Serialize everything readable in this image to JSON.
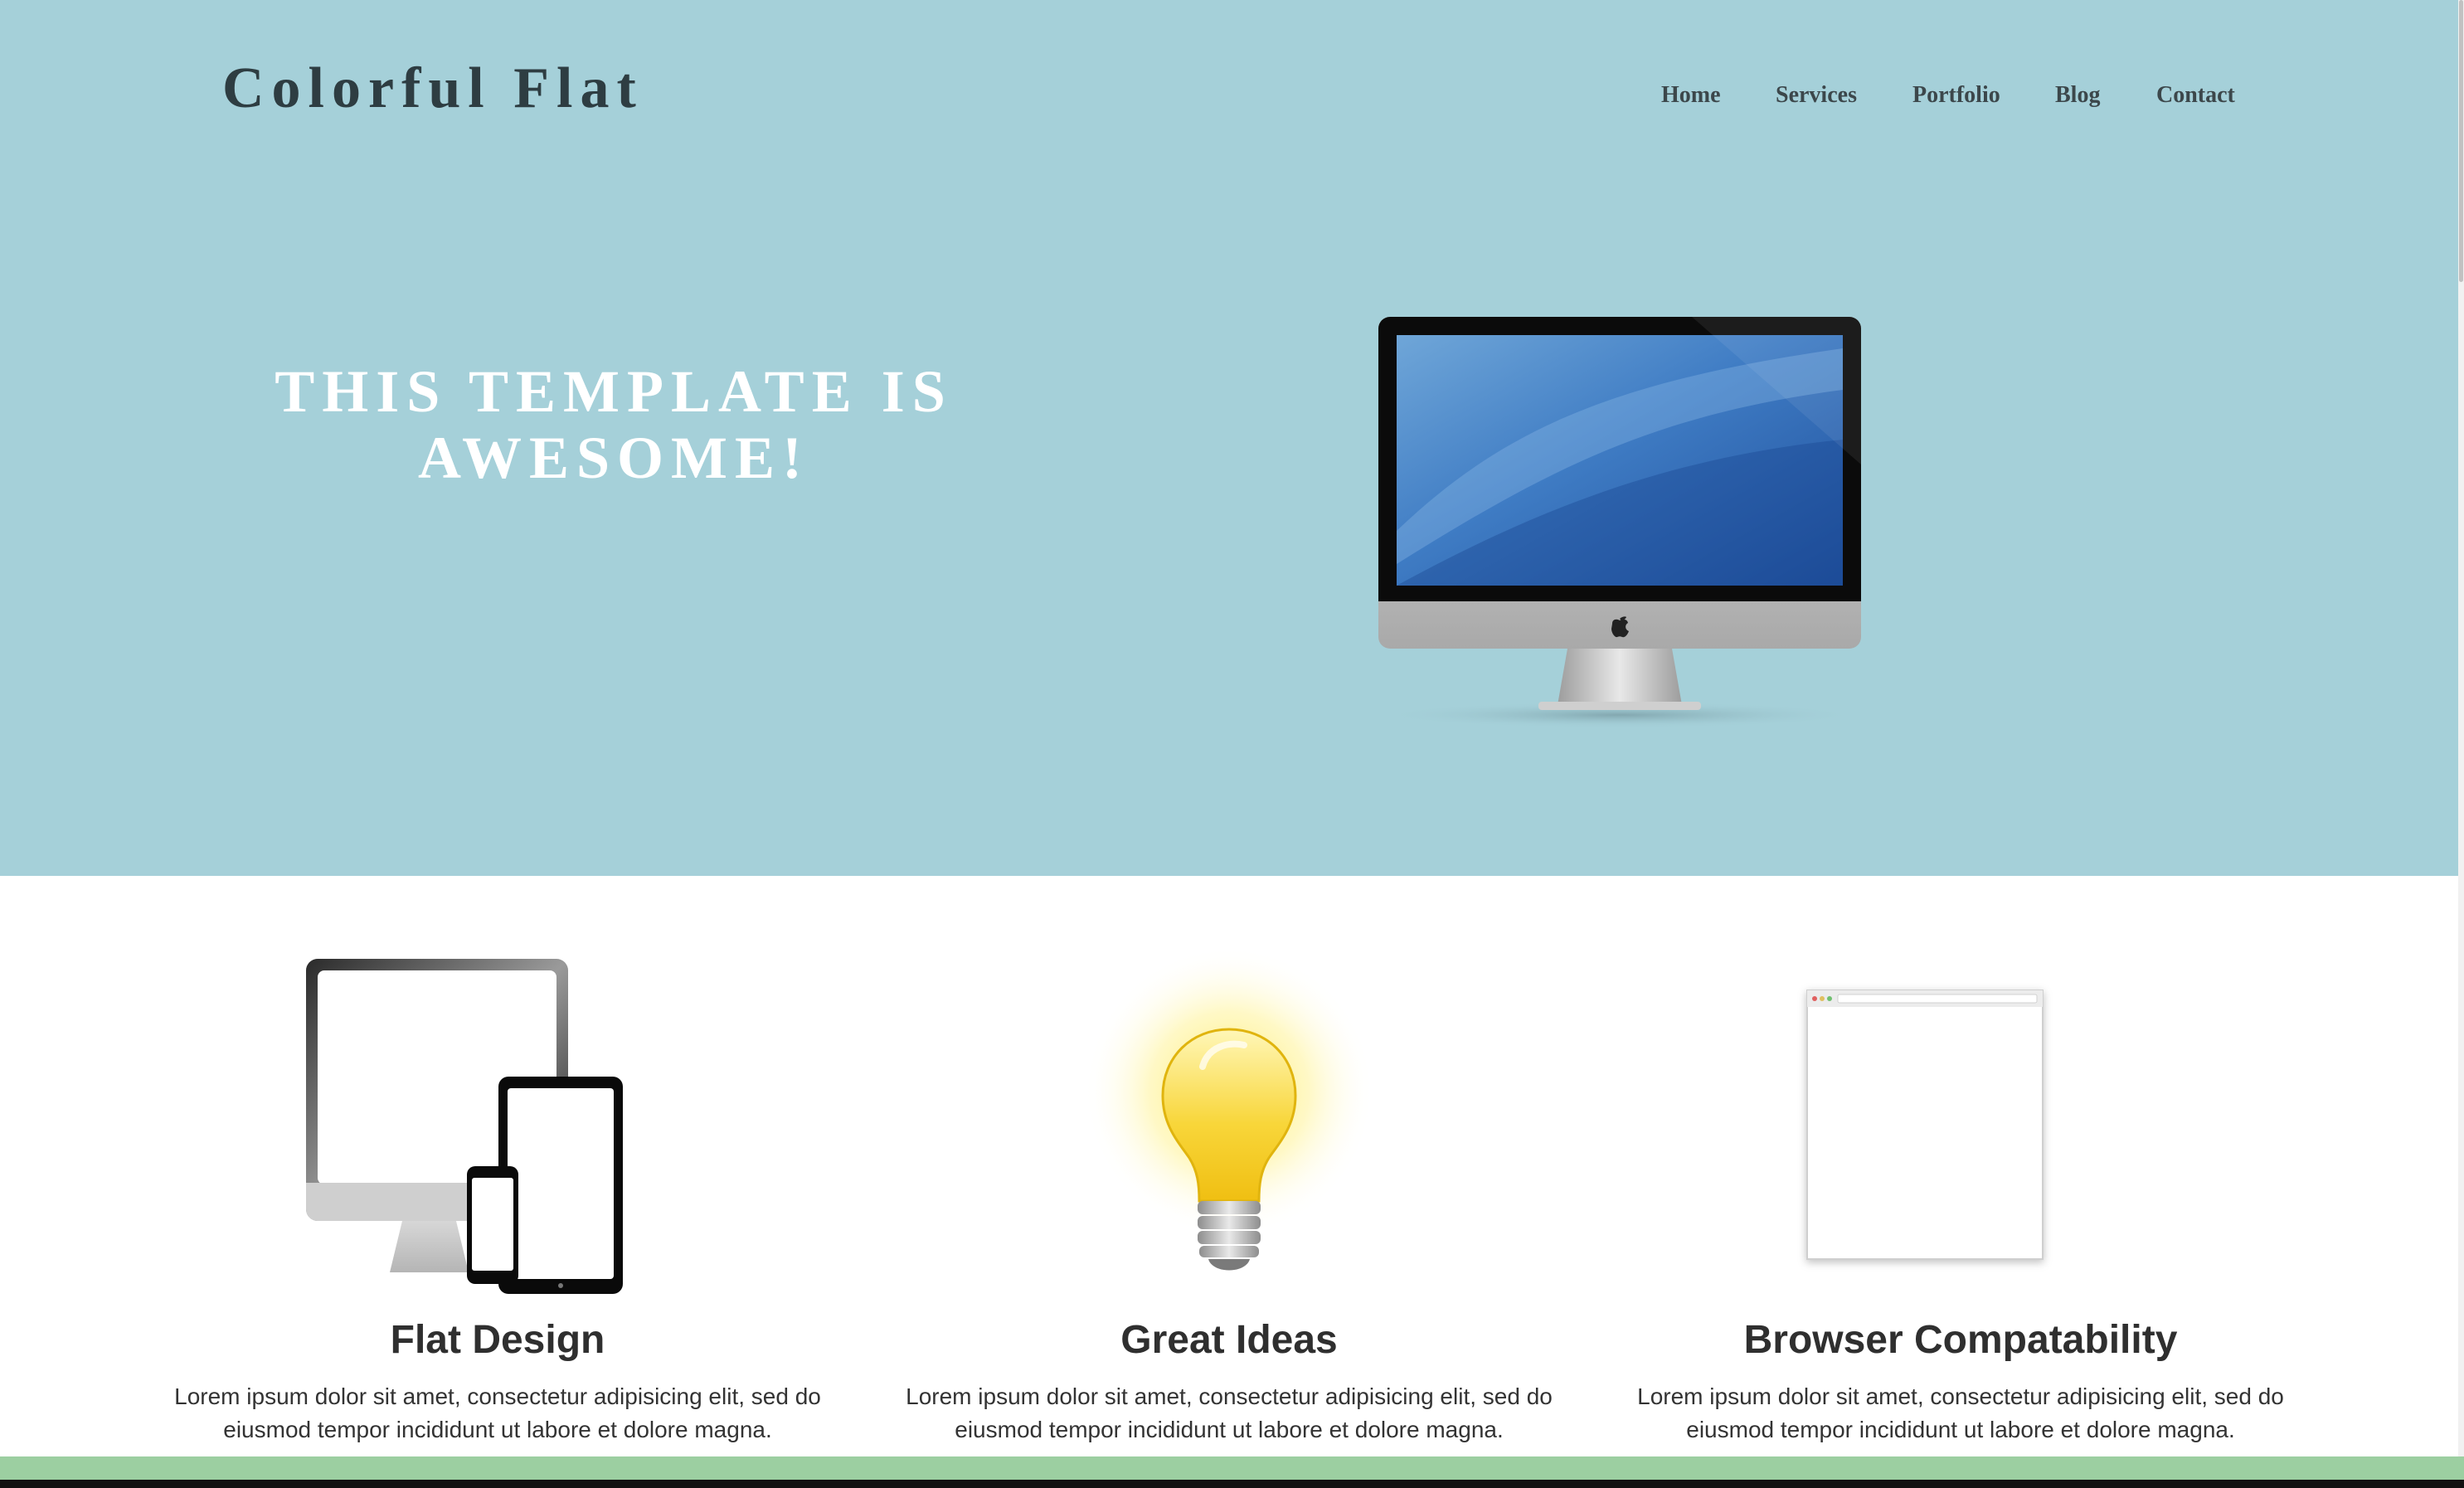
{
  "site": {
    "title": "Colorful Flat"
  },
  "nav": {
    "items": [
      "Home",
      "Services",
      "Portfolio",
      "Blog",
      "Contact"
    ]
  },
  "hero": {
    "line1": "THIS TEMPLATE IS",
    "line2": "AWESOME!"
  },
  "features": [
    {
      "title": "Flat Design",
      "text_line1": "Lorem ipsum dolor sit amet, consectetur adipisicing elit, sed do",
      "text_line2": "eiusmod tempor incididunt ut labore et dolore magna."
    },
    {
      "title": "Great Ideas",
      "text_line1": "Lorem ipsum dolor sit amet, consectetur adipisicing elit, sed do",
      "text_line2": "eiusmod tempor incididunt ut labore et dolore magna."
    },
    {
      "title": "Browser Compatability",
      "text_line1": "Lorem ipsum dolor sit amet, consectetur adipisicing elit, sed do",
      "text_line2": "eiusmod tempor incididunt ut labore et dolore magna."
    }
  ],
  "colors": {
    "hero_bg": "#a5d0d9",
    "heading": "#2e3d42",
    "footer_bar": "#9ccfa1"
  },
  "icons": [
    "imac-monitor-icon",
    "devices-icon",
    "lightbulb-icon",
    "browser-window-icon",
    "apple-logo-icon"
  ]
}
